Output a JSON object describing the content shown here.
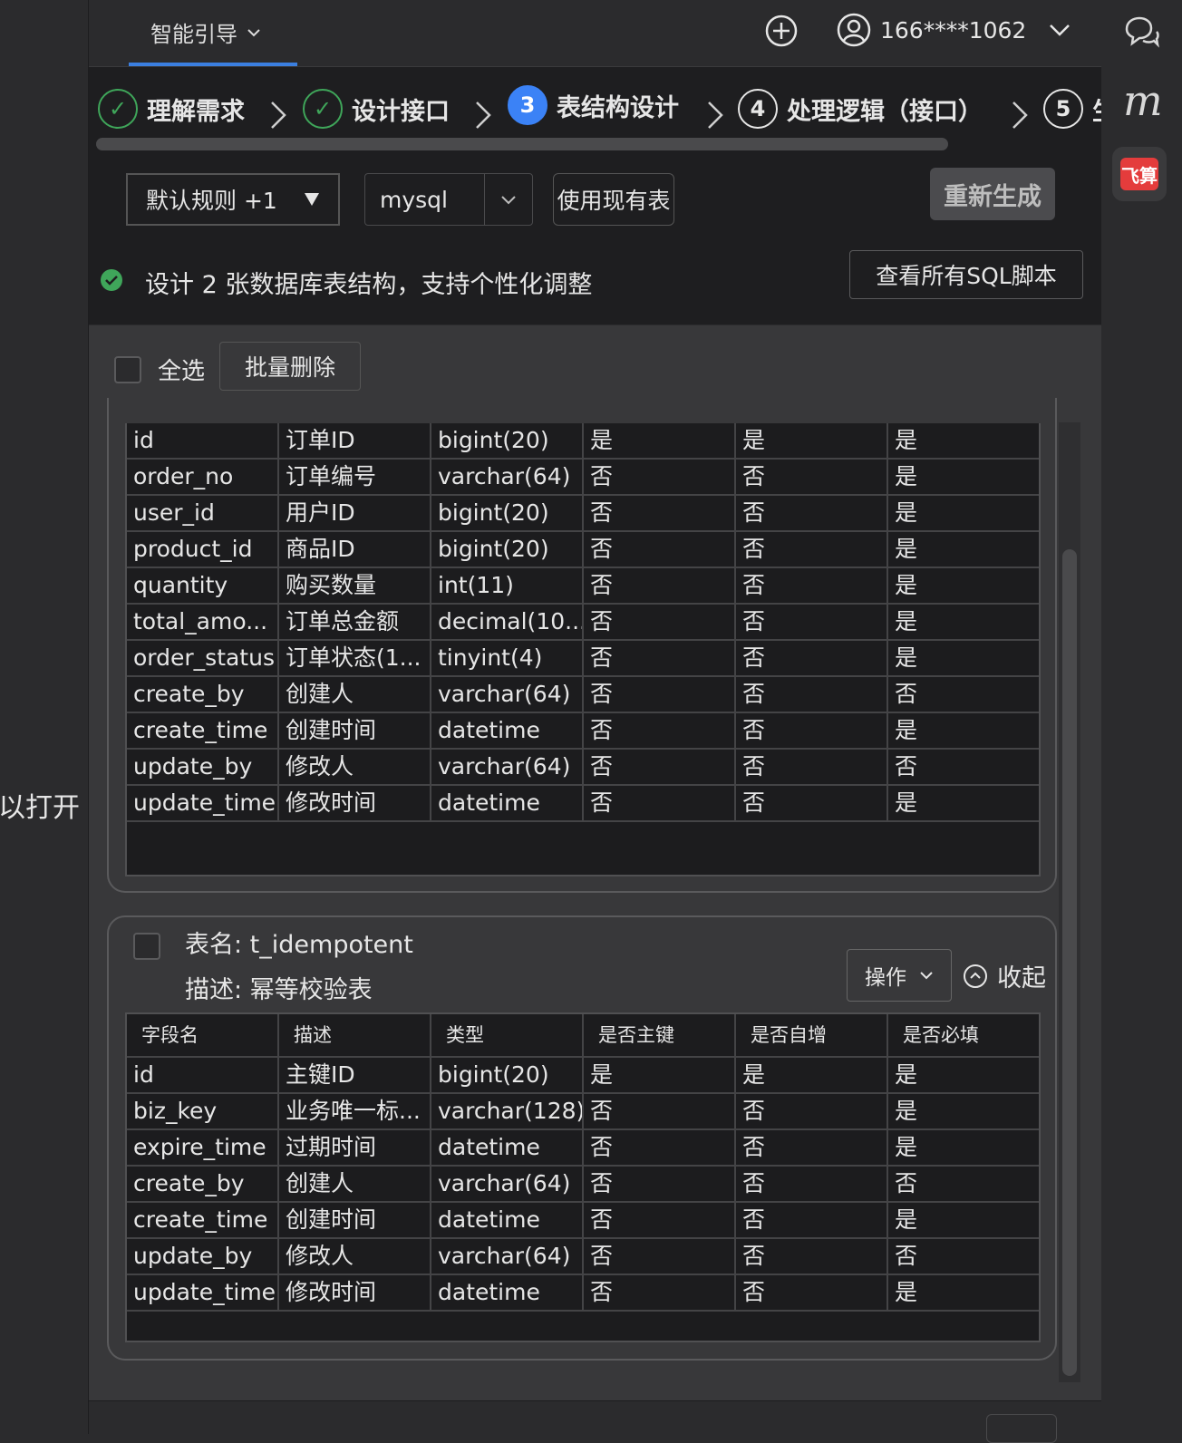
{
  "left_side": {
    "text": "以打开"
  },
  "topbar": {
    "tab_label": "智能引导",
    "user_phone": "166****1062"
  },
  "steps": [
    {
      "num": "✓",
      "label": "理解需求",
      "state": "done"
    },
    {
      "num": "✓",
      "label": "设计接口",
      "state": "done"
    },
    {
      "num": "3",
      "label": "表结构设计",
      "state": "active"
    },
    {
      "num": "4",
      "label": "处理逻辑（接口）",
      "state": "pending"
    },
    {
      "num": "5",
      "label": "生",
      "state": "pending"
    }
  ],
  "controls": {
    "rule_select": "默认规则 +1",
    "db_select": "mysql",
    "use_existing_label": "使用现有表",
    "regenerate_label": "重新生成"
  },
  "info": {
    "message": "设计 2 张数据库表结构，支持个性化调整",
    "view_sql_label": "查看所有SQL脚本"
  },
  "toolbar": {
    "select_all_label": "全选",
    "batch_delete_label": "批量删除"
  },
  "table1": {
    "rows": [
      [
        "id",
        "订单ID",
        "bigint(20)",
        "是",
        "是",
        "是"
      ],
      [
        "order_no",
        "订单编号",
        "varchar(64)",
        "否",
        "否",
        "是"
      ],
      [
        "user_id",
        "用户ID",
        "bigint(20)",
        "否",
        "否",
        "是"
      ],
      [
        "product_id",
        "商品ID",
        "bigint(20)",
        "否",
        "否",
        "是"
      ],
      [
        "quantity",
        "购买数量",
        "int(11)",
        "否",
        "否",
        "是"
      ],
      [
        "total_amo...",
        "订单总金额",
        "decimal(10...",
        "否",
        "否",
        "是"
      ],
      [
        "order_status",
        "订单状态(1...",
        "tinyint(4)",
        "否",
        "否",
        "是"
      ],
      [
        "create_by",
        "创建人",
        "varchar(64)",
        "否",
        "否",
        "否"
      ],
      [
        "create_time",
        "创建时间",
        "datetime",
        "否",
        "否",
        "是"
      ],
      [
        "update_by",
        "修改人",
        "varchar(64)",
        "否",
        "否",
        "否"
      ],
      [
        "update_time",
        "修改时间",
        "datetime",
        "否",
        "否",
        "是"
      ]
    ]
  },
  "table2": {
    "name_label": "表名: t_idempotent",
    "desc_label": "描述: 幂等校验表",
    "operate_label": "操作",
    "collapse_label": "收起",
    "headers": [
      "字段名",
      "描述",
      "类型",
      "是否主键",
      "是否自增",
      "是否必填"
    ],
    "rows": [
      [
        "id",
        "主键ID",
        "bigint(20)",
        "是",
        "是",
        "是"
      ],
      [
        "biz_key",
        "业务唯一标...",
        "varchar(128)",
        "否",
        "否",
        "是"
      ],
      [
        "expire_time",
        "过期时间",
        "datetime",
        "否",
        "否",
        "是"
      ],
      [
        "create_by",
        "创建人",
        "varchar(64)",
        "否",
        "否",
        "否"
      ],
      [
        "create_time",
        "创建时间",
        "datetime",
        "否",
        "否",
        "是"
      ],
      [
        "update_by",
        "修改人",
        "varchar(64)",
        "否",
        "否",
        "否"
      ],
      [
        "update_time",
        "修改时间",
        "datetime",
        "否",
        "否",
        "是"
      ]
    ]
  },
  "right_rail": {
    "icons": [
      "chat-bubble-icon",
      "m-logo-icon",
      "feisuan-app-icon"
    ],
    "feisuan_label": "飞算"
  },
  "colors": {
    "accent": "#3b82f6",
    "success": "#3fa65a",
    "brand_red": "#e43c3c"
  }
}
